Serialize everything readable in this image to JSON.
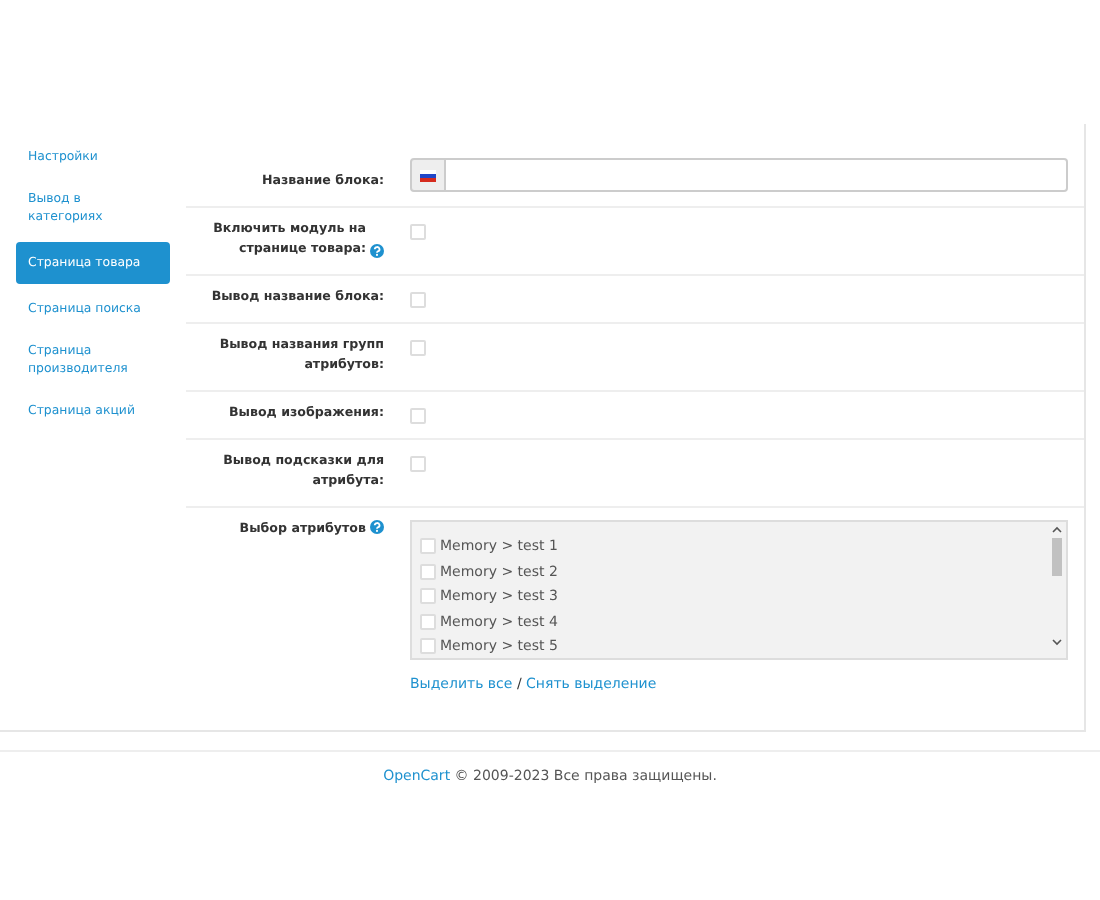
{
  "sidebar": {
    "items": [
      {
        "label": "Настройки",
        "selected": false
      },
      {
        "label": "Вывод в категориях",
        "selected": false
      },
      {
        "label": "Страница товара",
        "selected": true
      },
      {
        "label": "Страница поиска",
        "selected": false
      },
      {
        "label": "Страница производителя",
        "selected": false
      },
      {
        "label": "Страница акций",
        "selected": false
      }
    ]
  },
  "form": {
    "rows": [
      {
        "kind": "text",
        "label": "Название блока:",
        "help": false,
        "value": ""
      },
      {
        "kind": "checkbox",
        "label": "Включить модуль на странице товара:",
        "help": true,
        "checked": false
      },
      {
        "kind": "checkbox",
        "label": "Вывод название блока:",
        "help": false,
        "checked": false
      },
      {
        "kind": "checkbox",
        "label": "Вывод названия групп атрибутов:",
        "help": false,
        "checked": false
      },
      {
        "kind": "checkbox",
        "label": "Вывод изображения:",
        "help": false,
        "checked": false
      },
      {
        "kind": "checkbox",
        "label": "Вывод подсказки для атрибута:",
        "help": false,
        "checked": false
      },
      {
        "kind": "checklist",
        "label": "Выбор атрибутов",
        "help": true,
        "options": [
          {
            "label": "Memory > test 1",
            "checked": false
          },
          {
            "label": "Memory > test 2",
            "checked": false
          },
          {
            "label": "Memory > test 3",
            "checked": false
          },
          {
            "label": "Memory > test 4",
            "checked": false
          },
          {
            "label": "Memory > test 5",
            "checked": false
          }
        ],
        "select_all": "Выделить все",
        "separator": "/",
        "deselect_all": "Снять выделение"
      }
    ]
  },
  "footer": {
    "link": "OpenCart",
    "text": "© 2009-2023 Все права защищены."
  }
}
